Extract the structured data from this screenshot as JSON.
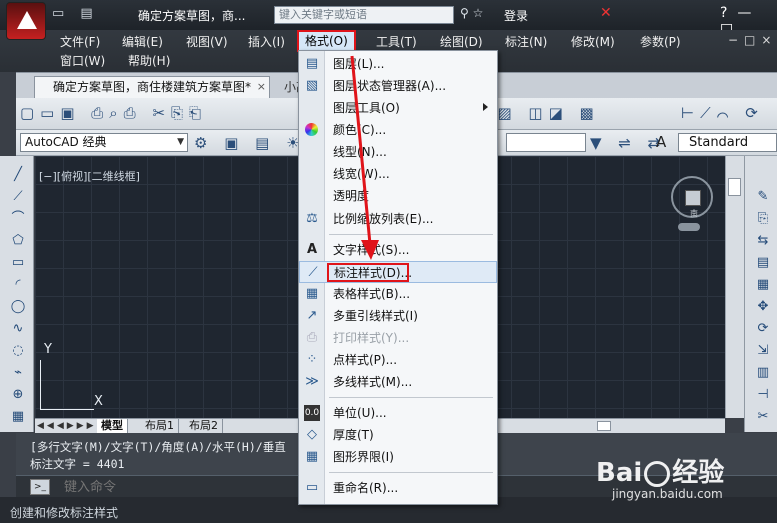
{
  "titlebar": {
    "window_title": "确定方案草图，商...",
    "search_placeholder": "键入关键字或短语",
    "login_label": "登录"
  },
  "menubar": {
    "items": [
      "文件(F)",
      "编辑(E)",
      "视图(V)",
      "插入(I)",
      "格式(O)",
      "工具(T)",
      "绘图(D)",
      "标注(N)",
      "修改(M)",
      "参数(P)",
      "窗口(W)",
      "帮助(H)"
    ]
  },
  "doc_tabs": {
    "active": "确定方案草图，商住楼建筑方案草图*",
    "close_glyph": "×",
    "second": "小高"
  },
  "toolbar2": {
    "workspace": "AutoCAD 经典",
    "text_style": "Standard"
  },
  "drawing": {
    "view_label": "[−][俯视][二维线框]",
    "viewcube_south": "南",
    "ucs_y": "Y",
    "ucs_x": "X"
  },
  "layout_tabs": [
    "模型",
    "布局1",
    "布局2"
  ],
  "command": {
    "history_line1": "[多行文字(M)/文字(T)/角度(A)/水平(H)/垂直",
    "history_line2": "标注文字 = 4401",
    "prompt_icon": ">_",
    "input_placeholder": "键入命令"
  },
  "status_text": "创建和修改标注样式",
  "format_menu": {
    "items": [
      {
        "label": "图层(L)...",
        "icon": "layer-icon",
        "enabled": true
      },
      {
        "label": "图层状态管理器(A)...",
        "icon": "layer-state-icon",
        "enabled": true
      },
      {
        "label": "图层工具(O)",
        "icon": "",
        "enabled": true,
        "submenu": true
      },
      {
        "label": "颜色(C)...",
        "icon": "color-wheel-icon",
        "enabled": true
      },
      {
        "label": "线型(N)...",
        "icon": "",
        "enabled": true
      },
      {
        "label": "线宽(W)...",
        "icon": "",
        "enabled": true
      },
      {
        "label": "透明度",
        "icon": "",
        "enabled": true
      },
      {
        "label": "比例缩放列表(E)...",
        "icon": "scale-list-icon",
        "enabled": true
      },
      {
        "label": "文字样式(S)...",
        "icon": "text-style-icon",
        "enabled": true
      },
      {
        "label": "标注样式(D)...",
        "icon": "dim-style-icon",
        "enabled": true,
        "highlighted": true
      },
      {
        "label": "表格样式(B)...",
        "icon": "table-style-icon",
        "enabled": true
      },
      {
        "label": "多重引线样式(I)",
        "icon": "mleader-style-icon",
        "enabled": true
      },
      {
        "label": "打印样式(Y)...",
        "icon": "plot-style-icon",
        "enabled": false
      },
      {
        "label": "点样式(P)...",
        "icon": "point-style-icon",
        "enabled": true
      },
      {
        "label": "多线样式(M)...",
        "icon": "mline-style-icon",
        "enabled": true
      },
      {
        "label": "单位(U)...",
        "icon": "units-icon",
        "enabled": true
      },
      {
        "label": "厚度(T)",
        "icon": "thickness-icon",
        "enabled": true
      },
      {
        "label": "图形界限(I)",
        "icon": "limits-icon",
        "enabled": true
      },
      {
        "label": "重命名(R)...",
        "icon": "rename-icon",
        "enabled": true
      }
    ]
  },
  "watermark": {
    "brand_left": "Bai",
    "brand_right": "经验",
    "url": "jingyan.baidu.com"
  },
  "colors": {
    "highlight_red": "#e0141a",
    "menu_hover": "#dfeaf6",
    "canvas": "#1f2630"
  }
}
